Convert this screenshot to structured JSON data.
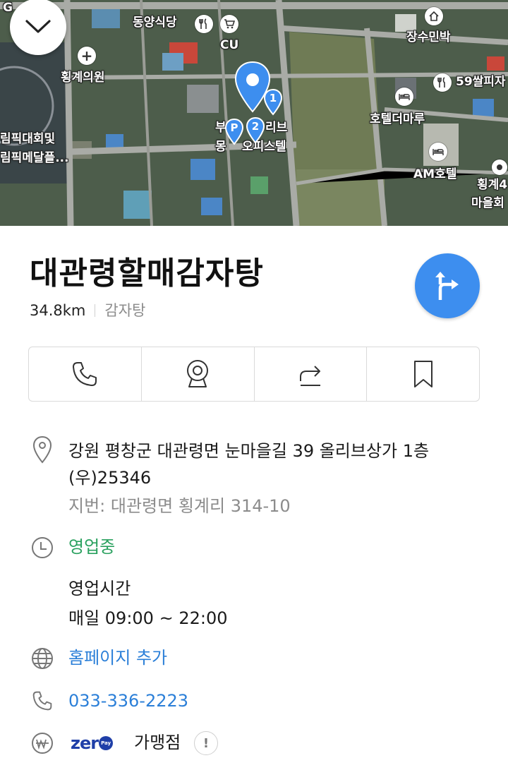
{
  "map": {
    "labels": [
      {
        "text": "G"
      },
      {
        "text": "동양식당"
      },
      {
        "text": "CU"
      },
      {
        "text": "횡계의원"
      },
      {
        "text": "장수민박"
      },
      {
        "text": "59쌀피자"
      },
      {
        "text": "호텔더마루"
      },
      {
        "text": "림픽대회및"
      },
      {
        "text": "림픽메달플..."
      },
      {
        "text": "부"
      },
      {
        "text": "리브"
      },
      {
        "text": "몽"
      },
      {
        "text": "오피스텔"
      },
      {
        "text": "AM호텔"
      },
      {
        "text": "횡계4"
      },
      {
        "text": "마을회"
      }
    ],
    "pin_badges": [
      "P",
      "2",
      "1"
    ]
  },
  "place": {
    "name": "대관령할매감자탕",
    "distance": "34.8km",
    "category": "감자탕"
  },
  "actions": [
    {
      "name": "call",
      "icon": "phone-icon"
    },
    {
      "name": "roadview",
      "icon": "camera-icon"
    },
    {
      "name": "share",
      "icon": "share-icon"
    },
    {
      "name": "save",
      "icon": "bookmark-icon"
    }
  ],
  "address": {
    "road": "강원 평창군 대관령면 눈마을길 39 올리브상가 1층",
    "postal": "(우)25346",
    "lot": "지번: 대관령면 횡계리 314-10"
  },
  "hours": {
    "status": "영업중",
    "title": "영업시간",
    "detail": "매일 09:00 ~ 22:00"
  },
  "homepage": {
    "label": "홈페이지 추가"
  },
  "phone": {
    "number": "033-336-2223"
  },
  "zeropay": {
    "logo_text": "zer",
    "logo_badge": "Pay",
    "label": "가맹점",
    "info_glyph": "!"
  },
  "colors": {
    "route_button": "#3d8eef",
    "pin": "#3d8eef",
    "open_status": "#2aa15f",
    "link": "#2b7fd8",
    "zeropay_logo": "#1f3fa8"
  }
}
